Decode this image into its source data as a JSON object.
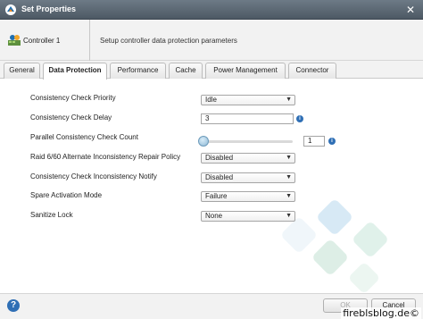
{
  "window": {
    "title": "Set Properties"
  },
  "header": {
    "controller_label": "Controller 1",
    "description": "Setup controller data protection parameters"
  },
  "tabs": [
    {
      "label": "General"
    },
    {
      "label": "Data Protection"
    },
    {
      "label": "Performance"
    },
    {
      "label": "Cache"
    },
    {
      "label": "Power Management"
    },
    {
      "label": "Connector"
    }
  ],
  "fields": {
    "consistency_check_priority": {
      "label": "Consistency Check Priority",
      "value": "Idle"
    },
    "consistency_check_delay": {
      "label": "Consistency Check Delay",
      "value": "3"
    },
    "parallel_consistency_check_count": {
      "label": "Parallel Consistency Check Count",
      "value": "1",
      "slider_level_pct": 0
    },
    "raid_alt_repair_policy": {
      "label": "Raid 6/60 Alternate Inconsistency Repair Policy",
      "value": "Disabled"
    },
    "consistency_check_notify": {
      "label": "Consistency Check Inconsistency Notify",
      "value": "Disabled"
    },
    "spare_activation_mode": {
      "label": "Spare Activation Mode",
      "value": "Failure"
    },
    "sanitize_lock": {
      "label": "Sanitize Lock",
      "value": "None"
    }
  },
  "footer": {
    "ok_label": "OK",
    "cancel_label": "Cancel"
  },
  "watermark": "fireblsblog.de©",
  "colors": {
    "titlebar": "#5a6671",
    "info_blue": "#2f6fb5"
  }
}
